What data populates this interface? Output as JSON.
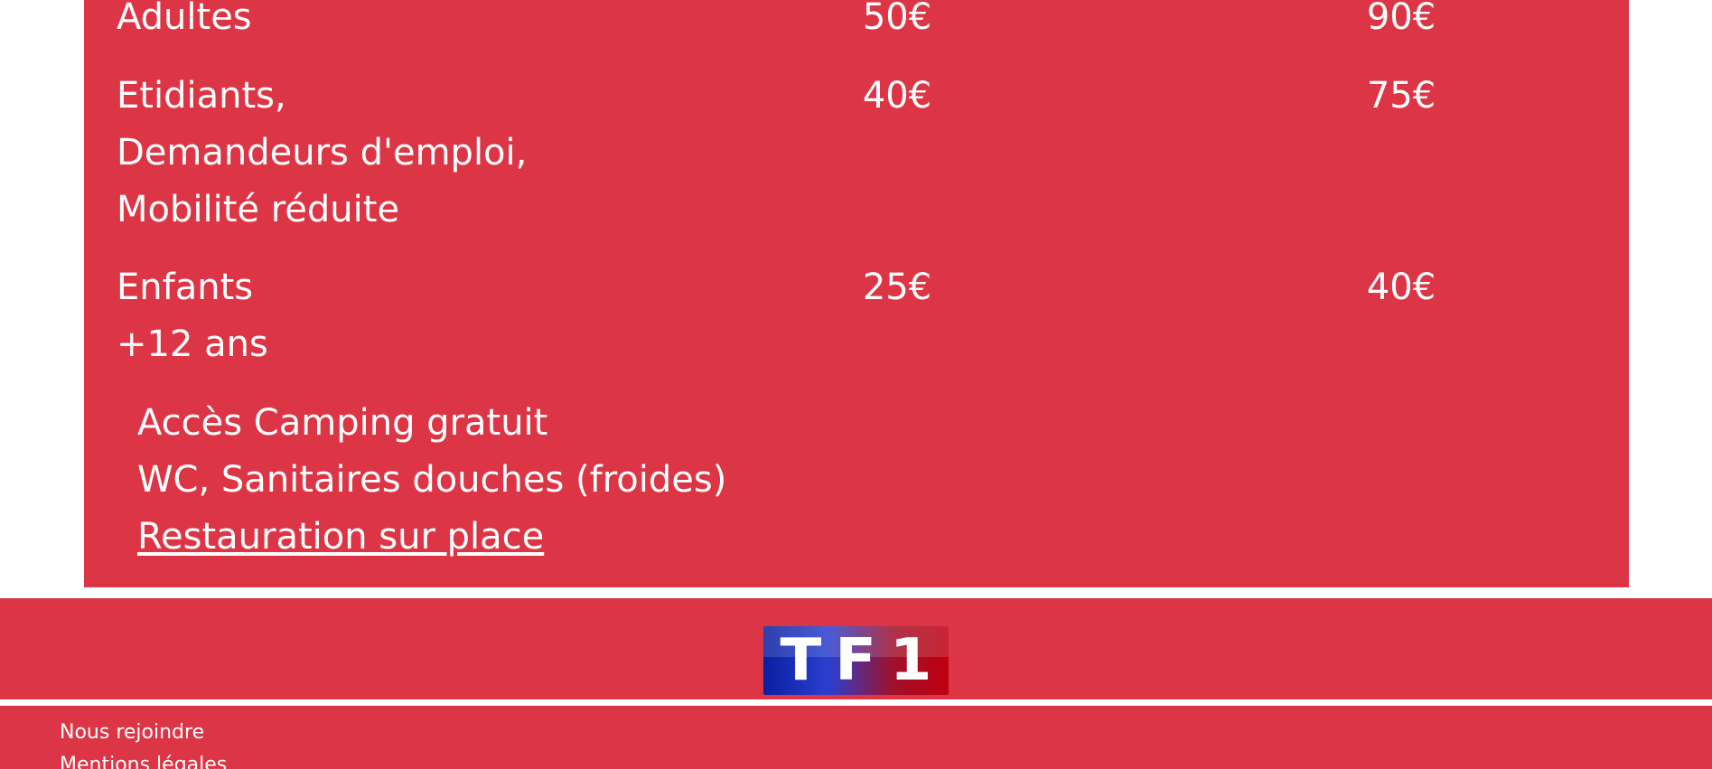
{
  "pricing": {
    "rows": [
      {
        "category_lines": [
          "Adultes"
        ],
        "price_a": "50€",
        "price_b": "90€"
      },
      {
        "category_lines": [
          "Etidiants,",
          "Demandeurs d'emploi,",
          "Mobilité réduite"
        ],
        "price_a": "40€",
        "price_b": "75€"
      },
      {
        "category_lines": [
          "Enfants",
          "+12 ans"
        ],
        "price_a": "25€",
        "price_b": "40€"
      }
    ],
    "amenities": [
      "Accès Camping gratuit",
      "WC, Sanitaires douches (froides)"
    ],
    "restauration_link": "Restauration sur place"
  },
  "logo": {
    "text": "TF1"
  },
  "footer": {
    "links": [
      "Nous rejoindre",
      "Mentions légales"
    ]
  },
  "colors": {
    "brand_red": "#dc3545",
    "text": "#ffffff"
  }
}
